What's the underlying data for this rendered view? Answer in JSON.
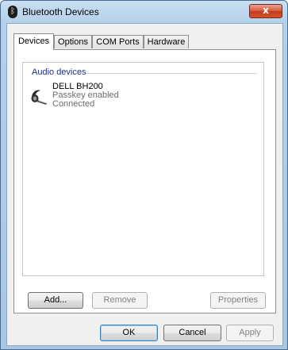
{
  "window": {
    "title": "Bluetooth Devices",
    "close_label": "x"
  },
  "tabs": [
    {
      "label": "Devices",
      "active": true
    },
    {
      "label": "Options",
      "active": false
    },
    {
      "label": "COM Ports",
      "active": false
    },
    {
      "label": "Hardware",
      "active": false
    }
  ],
  "device_list": {
    "group_header": "Audio devices",
    "devices": [
      {
        "name": "DELL BH200",
        "line1": "Passkey enabled",
        "line2": "Connected",
        "icon": "headset-icon"
      }
    ]
  },
  "page_buttons": {
    "add": "Add...",
    "remove": "Remove",
    "properties": "Properties"
  },
  "dialog_buttons": {
    "ok": "OK",
    "cancel": "Cancel",
    "apply": "Apply"
  }
}
